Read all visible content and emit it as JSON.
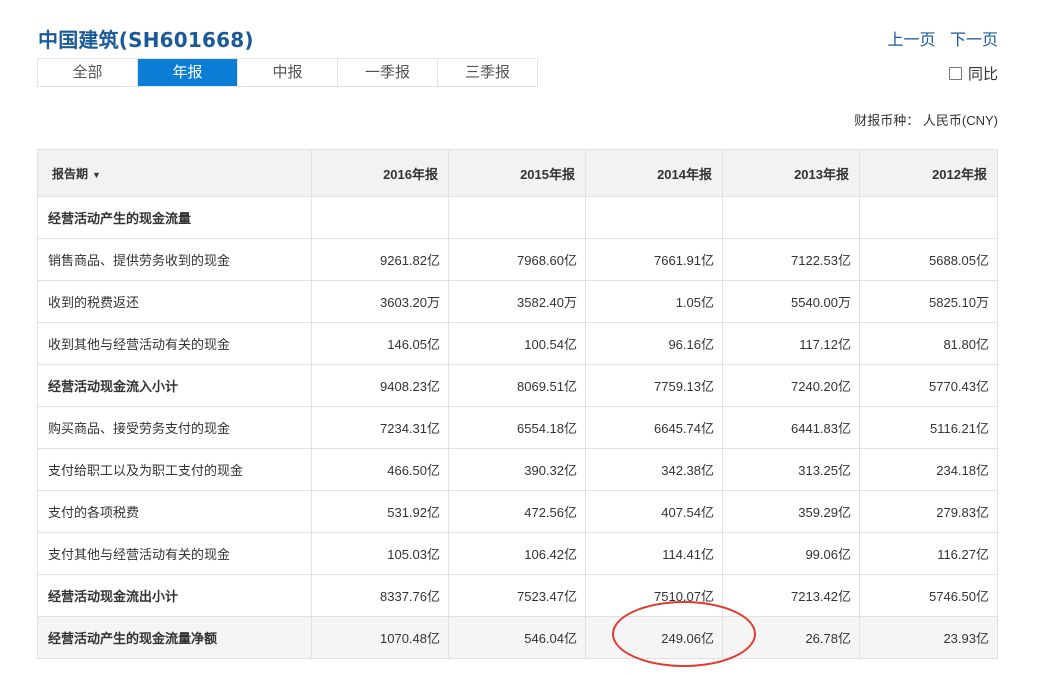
{
  "header": {
    "title": "中国建筑(SH601668)",
    "prev_page": "上一页",
    "next_page": "下一页"
  },
  "tabs": [
    {
      "label": "全部",
      "active": false
    },
    {
      "label": "年报",
      "active": true
    },
    {
      "label": "中报",
      "active": false
    },
    {
      "label": "一季报",
      "active": false
    },
    {
      "label": "三季报",
      "active": false
    }
  ],
  "compare": {
    "label": "同比",
    "checked": false
  },
  "currency_text": "财报币种： 人民币(CNY)",
  "table": {
    "period_header": "报告期",
    "sort_icon": "▼",
    "columns": [
      "2016年报",
      "2015年报",
      "2014年报",
      "2013年报",
      "2012年报"
    ],
    "rows": [
      {
        "label": "经营活动产生的现金流量",
        "values": [
          "",
          "",
          "",
          "",
          ""
        ],
        "bold": true
      },
      {
        "label": "销售商品、提供劳务收到的现金",
        "values": [
          "9261.82亿",
          "7968.60亿",
          "7661.91亿",
          "7122.53亿",
          "5688.05亿"
        ]
      },
      {
        "label": "收到的税费返还",
        "values": [
          "3603.20万",
          "3582.40万",
          "1.05亿",
          "5540.00万",
          "5825.10万"
        ]
      },
      {
        "label": "收到其他与经营活动有关的现金",
        "values": [
          "146.05亿",
          "100.54亿",
          "96.16亿",
          "117.12亿",
          "81.80亿"
        ]
      },
      {
        "label": "经营活动现金流入小计",
        "values": [
          "9408.23亿",
          "8069.51亿",
          "7759.13亿",
          "7240.20亿",
          "5770.43亿"
        ],
        "bold": true
      },
      {
        "label": "购买商品、接受劳务支付的现金",
        "values": [
          "7234.31亿",
          "6554.18亿",
          "6645.74亿",
          "6441.83亿",
          "5116.21亿"
        ]
      },
      {
        "label": "支付给职工以及为职工支付的现金",
        "values": [
          "466.50亿",
          "390.32亿",
          "342.38亿",
          "313.25亿",
          "234.18亿"
        ]
      },
      {
        "label": "支付的各项税费",
        "values": [
          "531.92亿",
          "472.56亿",
          "407.54亿",
          "359.29亿",
          "279.83亿"
        ]
      },
      {
        "label": "支付其他与经营活动有关的现金",
        "values": [
          "105.03亿",
          "106.42亿",
          "114.41亿",
          "99.06亿",
          "116.27亿"
        ]
      },
      {
        "label": "经营活动现金流出小计",
        "values": [
          "8337.76亿",
          "7523.47亿",
          "7510.07亿",
          "7213.42亿",
          "5746.50亿"
        ],
        "bold": true
      },
      {
        "label": "经营活动产生的现金流量净额",
        "values": [
          "1070.48亿",
          "546.04亿",
          "249.06亿",
          "26.78亿",
          "23.93亿"
        ],
        "bold": true,
        "shade": true
      }
    ]
  },
  "colors": {
    "accent": "#0b7dd4",
    "title": "#1b5a96",
    "annotation": "#e03a2f"
  }
}
